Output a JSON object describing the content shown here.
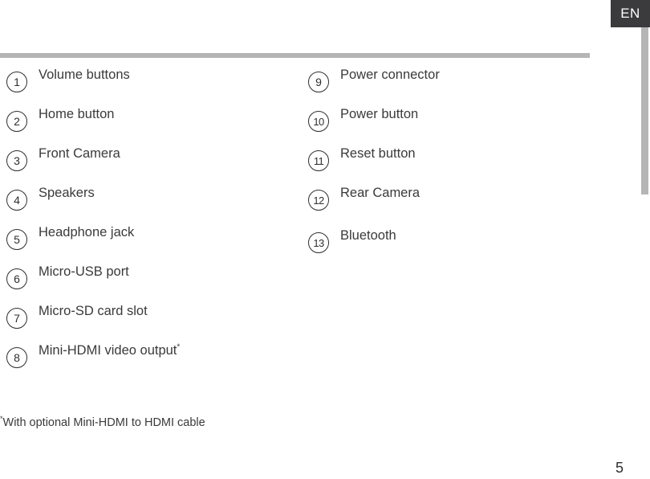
{
  "badge": {
    "language": "EN",
    "bg_color": "#3b3a3c",
    "text_color": "#ffffff"
  },
  "rule": {
    "color": "#b5b5b5"
  },
  "scrollbar": {
    "thumb_color": "#b5b5b5",
    "track_color": "#ffffff"
  },
  "legend": {
    "left_column": [
      {
        "number": "1",
        "label": "Volume buttons"
      },
      {
        "number": "2",
        "label": "Home button"
      },
      {
        "number": "3",
        "label": "Front Camera"
      },
      {
        "number": "4",
        "label": "Speakers"
      },
      {
        "number": "5",
        "label": "Headphone jack"
      },
      {
        "number": "6",
        "label": "Micro-USB port"
      },
      {
        "number": "7",
        "label": "Micro-SD card slot"
      },
      {
        "number": "8",
        "label": "Mini-HDMI video output",
        "footnote_marker": "*"
      }
    ],
    "right_column": [
      {
        "number": "9",
        "label": "Power connector"
      },
      {
        "number": "10",
        "label": "Power button"
      },
      {
        "number": "11",
        "label": "Reset button"
      },
      {
        "number": "12",
        "label": "Rear Camera"
      },
      {
        "number": "13",
        "label": "Bluetooth"
      }
    ]
  },
  "footnote": {
    "marker": "*",
    "text": "With optional Mini-HDMI to HDMI cable"
  },
  "page_number": "5"
}
